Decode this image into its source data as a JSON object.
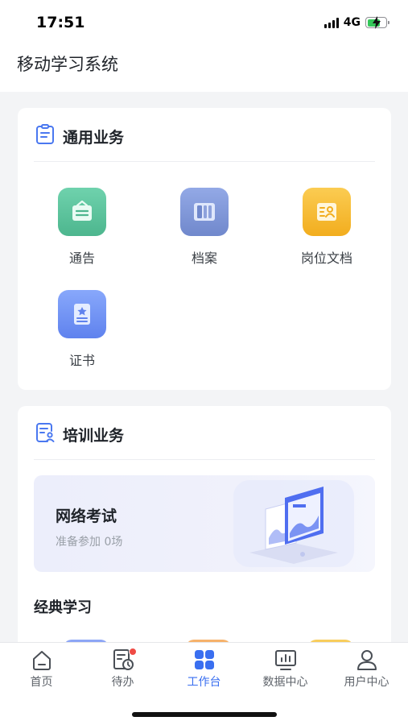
{
  "status": {
    "time": "17:51",
    "network": "4G",
    "battery_level": 0.7
  },
  "header": {
    "title": "移动学习系统"
  },
  "general": {
    "title": "通用业务",
    "items": [
      {
        "label": "通告",
        "icon": "notice-icon",
        "color": "#56c39b"
      },
      {
        "label": "档案",
        "icon": "archive-icon",
        "color": "#7f97d8"
      },
      {
        "label": "岗位文档",
        "icon": "job-document-icon",
        "color": "#f6bb33"
      },
      {
        "label": "证书",
        "icon": "certificate-icon",
        "color": "#6f93f4"
      }
    ]
  },
  "training": {
    "title": "培训业务",
    "exam": {
      "title": "网络考试",
      "subtitle": "准备参加 0场"
    },
    "classic_title": "经典学习"
  },
  "tabbar": {
    "items": [
      {
        "label": "首页",
        "icon": "home-icon",
        "active": false
      },
      {
        "label": "待办",
        "icon": "todo-icon",
        "active": false,
        "badge": true
      },
      {
        "label": "工作台",
        "icon": "workbench-icon",
        "active": true
      },
      {
        "label": "数据中心",
        "icon": "data-center-icon",
        "active": false
      },
      {
        "label": "用户中心",
        "icon": "user-center-icon",
        "active": false
      }
    ]
  },
  "colors": {
    "accent": "#3a6ff0",
    "badge": "#ef4b45"
  }
}
